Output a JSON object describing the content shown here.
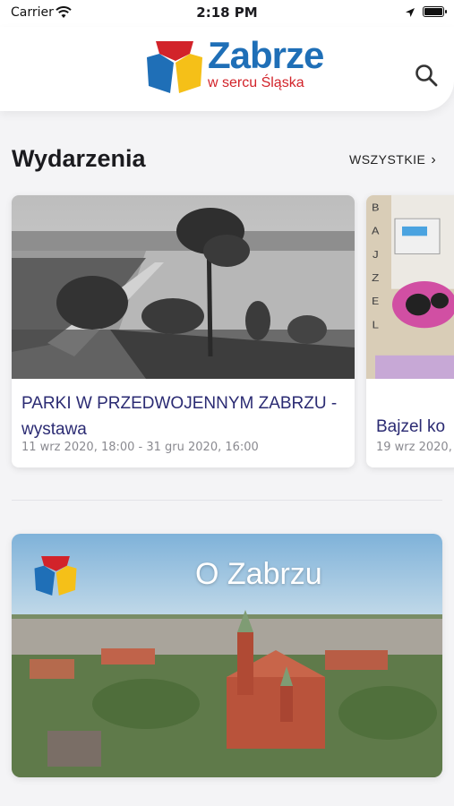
{
  "status_bar": {
    "carrier": "Carrier",
    "time": "2:18 PM"
  },
  "header": {
    "brand": "Zabrze",
    "tagline": "w sercu Śląska",
    "search_icon": "search-icon"
  },
  "events": {
    "title": "Wydarzenia",
    "see_all": "WSZYSTKIE",
    "cards": [
      {
        "title": "PARKI W PRZEDWOJENNYM ZABRZU - wystawa",
        "date": "11 wrz 2020, 18:00 - 31 gru 2020, 16:00"
      },
      {
        "title": "Bajzel ko",
        "date": "19 wrz 2020,",
        "poster_text": "BAJZEL"
      }
    ]
  },
  "about": {
    "title": "O Zabrzu"
  },
  "colors": {
    "brand_blue": "#1f6fb7",
    "brand_red": "#d2232a",
    "brand_yellow": "#f5c018",
    "card_title": "#2b2b73"
  }
}
